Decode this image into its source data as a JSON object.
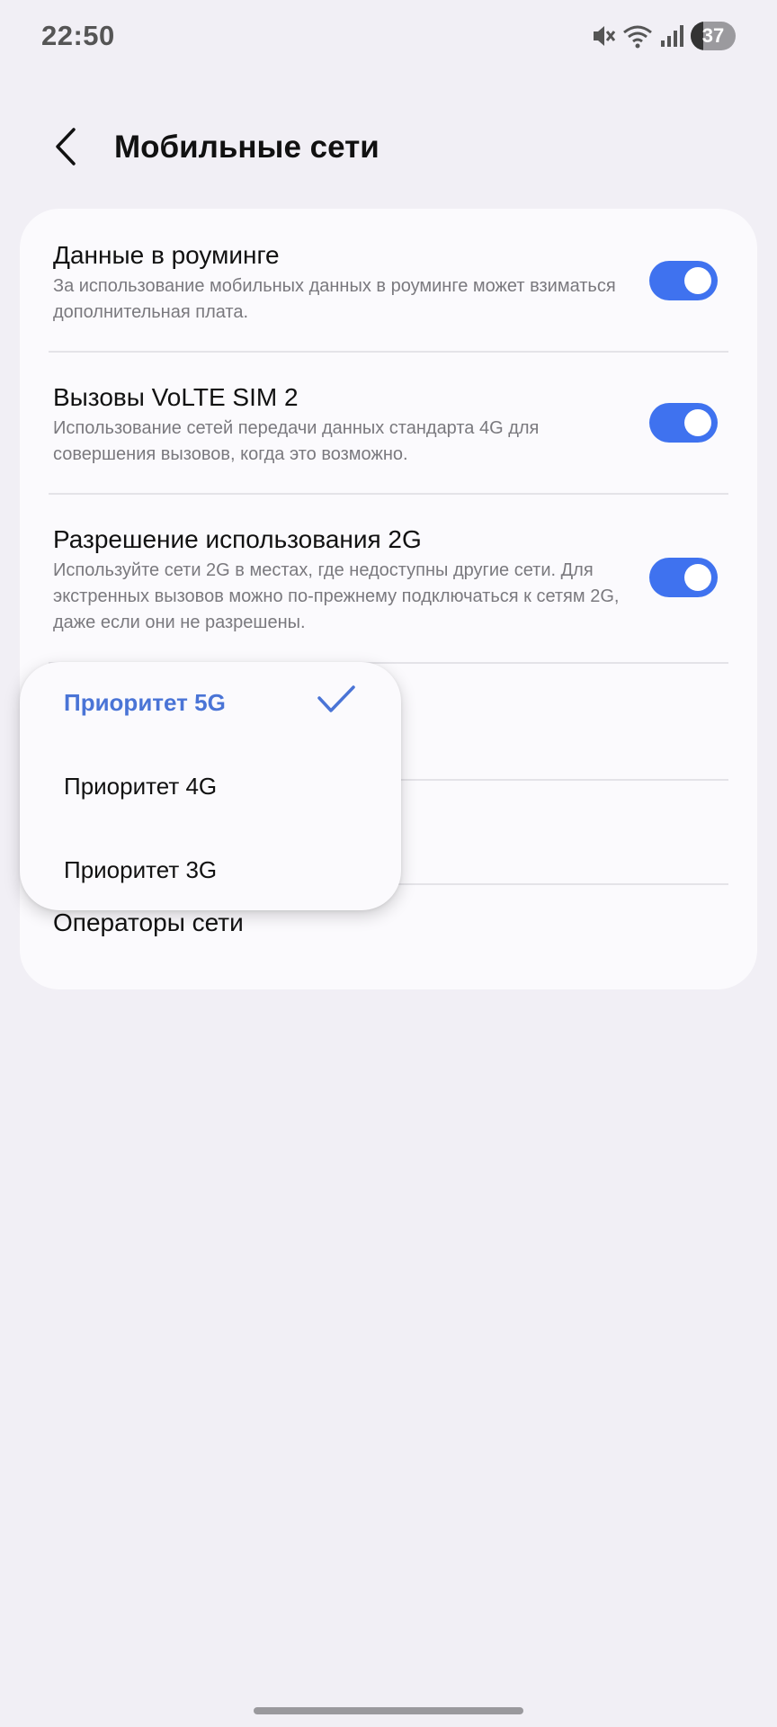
{
  "status_bar": {
    "time": "22:50",
    "battery_level": "37",
    "icons": [
      "mute-icon",
      "wifi-icon",
      "signal-icon",
      "battery-icon"
    ]
  },
  "header": {
    "title": "Мобильные сети",
    "back_icon": "chevron-left-icon"
  },
  "settings": {
    "roaming": {
      "title": "Данные в роуминге",
      "description": "За использование мобильных данных в роуминге может взиматься дополнительная плата.",
      "enabled": true
    },
    "volte": {
      "title": "Вызовы VoLTE SIM 2",
      "description": "Использование сетей передачи данных стандарта 4G для совершения вызовов, когда это возможно.",
      "enabled": true
    },
    "allow_2g": {
      "title": "Разрешение использования 2G",
      "description": "Используйте сети 2G в местах, где недоступны другие сети. Для экстренных вызовов можно по-прежнему подключаться к сетям 2G, даже если они не разрешены.",
      "enabled": true
    },
    "operators": {
      "title": "Операторы сети"
    }
  },
  "network_mode_menu": {
    "selected": "Приоритет 5G",
    "options": [
      "Приоритет 5G",
      "Приоритет 4G",
      "Приоритет 3G"
    ]
  },
  "colors": {
    "accent": "#3f72ef",
    "selected_text": "#4a74d6",
    "background": "#f1eff5",
    "card": "#fbfafd"
  }
}
